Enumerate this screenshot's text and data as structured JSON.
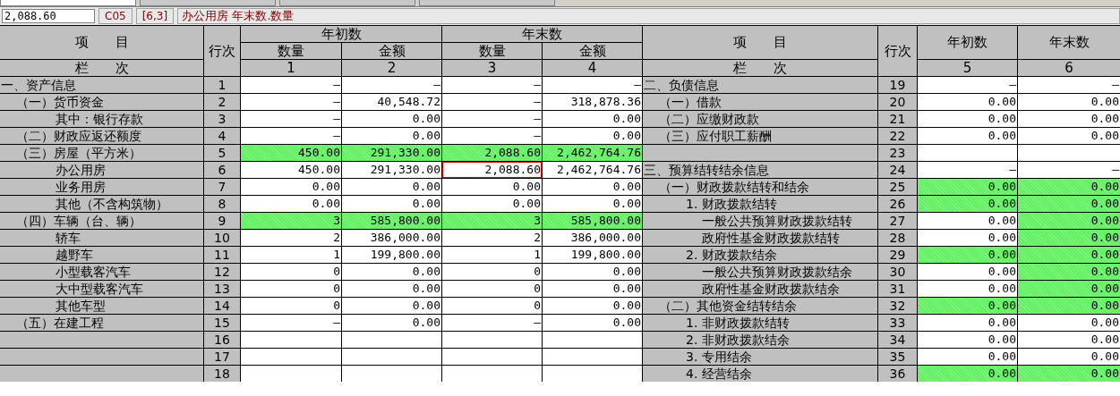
{
  "sheet_tabs": [
    {
      "selected": true
    },
    {
      "selected": false
    },
    {
      "selected": false
    },
    {
      "selected": false
    }
  ],
  "formula_bar": {
    "value": "2,088.60",
    "cell": "C05",
    "position": "[6,3]",
    "description": "办公用房 年末数.数量"
  },
  "header": {
    "left_item": "项　　目",
    "left_line": "行次",
    "groups": [
      {
        "label": "年初数",
        "columns": [
          "数量",
          "金额"
        ]
      },
      {
        "label": "年末数",
        "columns": [
          "数量",
          "金额"
        ]
      }
    ],
    "left_index": "栏　　次",
    "left_numbers": [
      "1",
      "2",
      "3",
      "4"
    ],
    "right_item": "项　　目",
    "right_line": "行次",
    "right_columns": [
      "年初数",
      "年末数"
    ],
    "right_index": "栏　　次",
    "right_numbers": [
      "5",
      "6"
    ]
  },
  "rows": [
    {
      "left": {
        "label": "一、资产信息",
        "kind": "section",
        "line": "1",
        "cells": [
          {
            "text": "—",
            "highlighted": false,
            "selected": false
          },
          {
            "text": "—",
            "highlighted": false,
            "selected": false
          },
          {
            "text": "—",
            "highlighted": false,
            "selected": false
          },
          {
            "text": "—",
            "highlighted": false,
            "selected": false
          }
        ]
      },
      "right": {
        "label": "二、负债信息",
        "kind": "section",
        "line": "19",
        "cells": [
          {
            "text": "—",
            "highlighted": false,
            "selected": false
          },
          {
            "text": "—",
            "highlighted": false,
            "selected": false
          }
        ]
      }
    },
    {
      "left": {
        "label": "（一）货币资金",
        "kind": "group",
        "line": "2",
        "cells": [
          {
            "text": "—",
            "highlighted": false,
            "selected": false
          },
          {
            "text": "40,548.72",
            "highlighted": false,
            "selected": false
          },
          {
            "text": "—",
            "highlighted": false,
            "selected": false
          },
          {
            "text": "318,878.36",
            "highlighted": false,
            "selected": false
          }
        ]
      },
      "right": {
        "label": "（一）借款",
        "kind": "group",
        "line": "20",
        "cells": [
          {
            "text": "0.00",
            "highlighted": false,
            "selected": false
          },
          {
            "text": "0.00",
            "highlighted": false,
            "selected": false
          }
        ]
      }
    },
    {
      "left": {
        "label": "其中：银行存款",
        "kind": "item",
        "line": "3",
        "cells": [
          {
            "text": "—",
            "highlighted": false,
            "selected": false
          },
          {
            "text": "0.00",
            "highlighted": false,
            "selected": false
          },
          {
            "text": "—",
            "highlighted": false,
            "selected": false
          },
          {
            "text": "0.00",
            "highlighted": false,
            "selected": false
          }
        ]
      },
      "right": {
        "label": "（二）应缴财政款",
        "kind": "group",
        "line": "21",
        "cells": [
          {
            "text": "0.00",
            "highlighted": false,
            "selected": false
          },
          {
            "text": "0.00",
            "highlighted": false,
            "selected": false
          }
        ]
      }
    },
    {
      "left": {
        "label": "（二）财政应返还额度",
        "kind": "group",
        "line": "4",
        "cells": [
          {
            "text": "—",
            "highlighted": false,
            "selected": false
          },
          {
            "text": "0.00",
            "highlighted": false,
            "selected": false
          },
          {
            "text": "—",
            "highlighted": false,
            "selected": false
          },
          {
            "text": "0.00",
            "highlighted": false,
            "selected": false
          }
        ]
      },
      "right": {
        "label": "（三）应付职工薪酬",
        "kind": "group",
        "line": "22",
        "cells": [
          {
            "text": "0.00",
            "highlighted": false,
            "selected": false
          },
          {
            "text": "0.00",
            "highlighted": false,
            "selected": false
          }
        ]
      }
    },
    {
      "left": {
        "label": "（三）房屋（平方米）",
        "kind": "group",
        "line": "5",
        "cells": [
          {
            "text": "450.00",
            "highlighted": true,
            "selected": false
          },
          {
            "text": "291,330.00",
            "highlighted": true,
            "selected": false
          },
          {
            "text": "2,088.60",
            "highlighted": true,
            "selected": false
          },
          {
            "text": "2,462,764.76",
            "highlighted": true,
            "selected": false
          }
        ]
      },
      "right": {
        "kind": "section",
        "line": "23",
        "cells": [
          {
            "highlighted": false,
            "selected": false
          },
          {
            "highlighted": false,
            "selected": false
          }
        ]
      }
    },
    {
      "left": {
        "label": "办公用房",
        "kind": "item",
        "line": "6",
        "cells": [
          {
            "text": "450.00",
            "highlighted": false,
            "selected": false
          },
          {
            "text": "291,330.00",
            "highlighted": false,
            "selected": false
          },
          {
            "text": "2,088.60",
            "highlighted": false,
            "selected": true
          },
          {
            "text": "2,462,764.76",
            "highlighted": false,
            "selected": false
          }
        ]
      },
      "right": {
        "label": "三、预算结转结余信息",
        "kind": "section",
        "line": "24",
        "cells": [
          {
            "text": "—",
            "highlighted": false,
            "selected": false
          },
          {
            "text": "—",
            "highlighted": false,
            "selected": false
          }
        ]
      }
    },
    {
      "left": {
        "label": "业务用房",
        "kind": "item",
        "line": "7",
        "cells": [
          {
            "text": "0.00",
            "highlighted": false,
            "selected": false
          },
          {
            "text": "0.00",
            "highlighted": false,
            "selected": false
          },
          {
            "text": "0.00",
            "highlighted": false,
            "selected": false
          },
          {
            "text": "0.00",
            "highlighted": false,
            "selected": false
          }
        ]
      },
      "right": {
        "label": "（一）财政拨款结转和结余",
        "kind": "group",
        "line": "25",
        "cells": [
          {
            "text": "0.00",
            "highlighted": true,
            "selected": false
          },
          {
            "text": "0.00",
            "highlighted": true,
            "selected": false
          }
        ]
      }
    },
    {
      "left": {
        "label": "其他（不含构筑物）",
        "kind": "item",
        "line": "8",
        "cells": [
          {
            "text": "0.00",
            "highlighted": false,
            "selected": false
          },
          {
            "text": "0.00",
            "highlighted": false,
            "selected": false
          },
          {
            "text": "0.00",
            "highlighted": false,
            "selected": false
          },
          {
            "text": "0.00",
            "highlighted": false,
            "selected": false
          }
        ]
      },
      "right": {
        "label": "1. 财政拨款结转",
        "kind": "sub",
        "line": "26",
        "cells": [
          {
            "text": "0.00",
            "highlighted": true,
            "selected": false
          },
          {
            "text": "0.00",
            "highlighted": true,
            "selected": false
          }
        ]
      }
    },
    {
      "left": {
        "label": "（四）车辆（台、辆）",
        "kind": "group",
        "line": "9",
        "cells": [
          {
            "text": "3",
            "highlighted": true,
            "selected": false
          },
          {
            "text": "585,800.00",
            "highlighted": true,
            "selected": false
          },
          {
            "text": "3",
            "highlighted": true,
            "selected": false
          },
          {
            "text": "585,800.00",
            "highlighted": true,
            "selected": false
          }
        ]
      },
      "right": {
        "label": "一般公共预算财政拨款结转",
        "kind": "detail",
        "line": "27",
        "cells": [
          {
            "text": "0.00",
            "highlighted": false,
            "selected": false
          },
          {
            "text": "0.00",
            "highlighted": true,
            "selected": false
          }
        ]
      }
    },
    {
      "left": {
        "label": "轿车",
        "kind": "item",
        "line": "10",
        "cells": [
          {
            "text": "2",
            "highlighted": false,
            "selected": false
          },
          {
            "text": "386,000.00",
            "highlighted": false,
            "selected": false
          },
          {
            "text": "2",
            "highlighted": false,
            "selected": false
          },
          {
            "text": "386,000.00",
            "highlighted": false,
            "selected": false
          }
        ]
      },
      "right": {
        "label": "政府性基金财政拨款结转",
        "kind": "detail",
        "line": "28",
        "cells": [
          {
            "text": "0.00",
            "highlighted": false,
            "selected": false
          },
          {
            "text": "0.00",
            "highlighted": true,
            "selected": false
          }
        ]
      }
    },
    {
      "left": {
        "label": "越野车",
        "kind": "item",
        "line": "11",
        "cells": [
          {
            "text": "1",
            "highlighted": false,
            "selected": false
          },
          {
            "text": "199,800.00",
            "highlighted": false,
            "selected": false
          },
          {
            "text": "1",
            "highlighted": false,
            "selected": false
          },
          {
            "text": "199,800.00",
            "highlighted": false,
            "selected": false
          }
        ]
      },
      "right": {
        "label": "2. 财政拨款结余",
        "kind": "sub",
        "line": "29",
        "cells": [
          {
            "text": "0.00",
            "highlighted": true,
            "selected": false
          },
          {
            "text": "0.00",
            "highlighted": true,
            "selected": false
          }
        ]
      }
    },
    {
      "left": {
        "label": "小型载客汽车",
        "kind": "item",
        "line": "12",
        "cells": [
          {
            "text": "0",
            "highlighted": false,
            "selected": false
          },
          {
            "text": "0.00",
            "highlighted": false,
            "selected": false
          },
          {
            "text": "0",
            "highlighted": false,
            "selected": false
          },
          {
            "text": "0.00",
            "highlighted": false,
            "selected": false
          }
        ]
      },
      "right": {
        "label": "一般公共预算财政拨款结余",
        "kind": "detail",
        "line": "30",
        "cells": [
          {
            "text": "0.00",
            "highlighted": false,
            "selected": false
          },
          {
            "text": "0.00",
            "highlighted": true,
            "selected": false
          }
        ]
      }
    },
    {
      "left": {
        "label": "大中型载客汽车",
        "kind": "item",
        "line": "13",
        "cells": [
          {
            "text": "0",
            "highlighted": false,
            "selected": false
          },
          {
            "text": "0.00",
            "highlighted": false,
            "selected": false
          },
          {
            "text": "0",
            "highlighted": false,
            "selected": false
          },
          {
            "text": "0.00",
            "highlighted": false,
            "selected": false
          }
        ]
      },
      "right": {
        "label": "政府性基金财政拨款结余",
        "kind": "detail",
        "line": "31",
        "cells": [
          {
            "text": "0.00",
            "highlighted": false,
            "selected": false
          },
          {
            "text": "0.00",
            "highlighted": true,
            "selected": false
          }
        ]
      }
    },
    {
      "left": {
        "label": "其他车型",
        "kind": "item",
        "line": "14",
        "cells": [
          {
            "text": "0",
            "highlighted": false,
            "selected": false
          },
          {
            "text": "0.00",
            "highlighted": false,
            "selected": false
          },
          {
            "text": "0",
            "highlighted": false,
            "selected": false
          },
          {
            "text": "0.00",
            "highlighted": false,
            "selected": false
          }
        ]
      },
      "right": {
        "label": "（二）其他资金结转结余",
        "kind": "group",
        "line": "32",
        "cells": [
          {
            "text": "0.00",
            "highlighted": true,
            "selected": false
          },
          {
            "text": "0.00",
            "highlighted": true,
            "selected": false
          }
        ]
      }
    },
    {
      "left": {
        "label": "（五）在建工程",
        "kind": "group",
        "line": "15",
        "cells": [
          {
            "text": "—",
            "highlighted": false,
            "selected": false
          },
          {
            "text": "0.00",
            "highlighted": false,
            "selected": false
          },
          {
            "text": "—",
            "highlighted": false,
            "selected": false
          },
          {
            "text": "0.00",
            "highlighted": false,
            "selected": false
          }
        ]
      },
      "right": {
        "label": "1. 非财政拨款结转",
        "kind": "sub",
        "line": "33",
        "cells": [
          {
            "text": "0.00",
            "highlighted": false,
            "selected": false
          },
          {
            "text": "0.00",
            "highlighted": false,
            "selected": false
          }
        ]
      }
    },
    {
      "left": {
        "kind": "item",
        "line": "16",
        "cells": [
          {
            "highlighted": false,
            "selected": false
          },
          {
            "highlighted": false,
            "selected": false
          },
          {
            "highlighted": false,
            "selected": false
          },
          {
            "highlighted": false,
            "selected": false
          }
        ]
      },
      "right": {
        "label": "2. 非财政拨款结余",
        "kind": "sub",
        "line": "34",
        "cells": [
          {
            "text": "0.00",
            "highlighted": false,
            "selected": false
          },
          {
            "text": "0.00",
            "highlighted": false,
            "selected": false
          }
        ]
      }
    },
    {
      "left": {
        "kind": "item",
        "line": "17",
        "cells": [
          {
            "highlighted": false,
            "selected": false
          },
          {
            "highlighted": false,
            "selected": false
          },
          {
            "highlighted": false,
            "selected": false
          },
          {
            "highlighted": false,
            "selected": false
          }
        ]
      },
      "right": {
        "label": "3. 专用结余",
        "kind": "sub",
        "line": "35",
        "cells": [
          {
            "text": "0.00",
            "highlighted": false,
            "selected": false
          },
          {
            "text": "0.00",
            "highlighted": false,
            "selected": false
          }
        ]
      }
    },
    {
      "left": {
        "kind": "item",
        "line": "18",
        "cells": [
          {
            "highlighted": false,
            "selected": false
          },
          {
            "highlighted": false,
            "selected": false
          },
          {
            "highlighted": false,
            "selected": false
          },
          {
            "highlighted": false,
            "selected": false
          }
        ]
      },
      "right": {
        "label": "4. 经营结余",
        "kind": "sub",
        "line": "36",
        "cells": [
          {
            "text": "0.00",
            "highlighted": true,
            "selected": false
          },
          {
            "text": "0.00",
            "highlighted": true,
            "selected": false
          }
        ]
      }
    }
  ]
}
